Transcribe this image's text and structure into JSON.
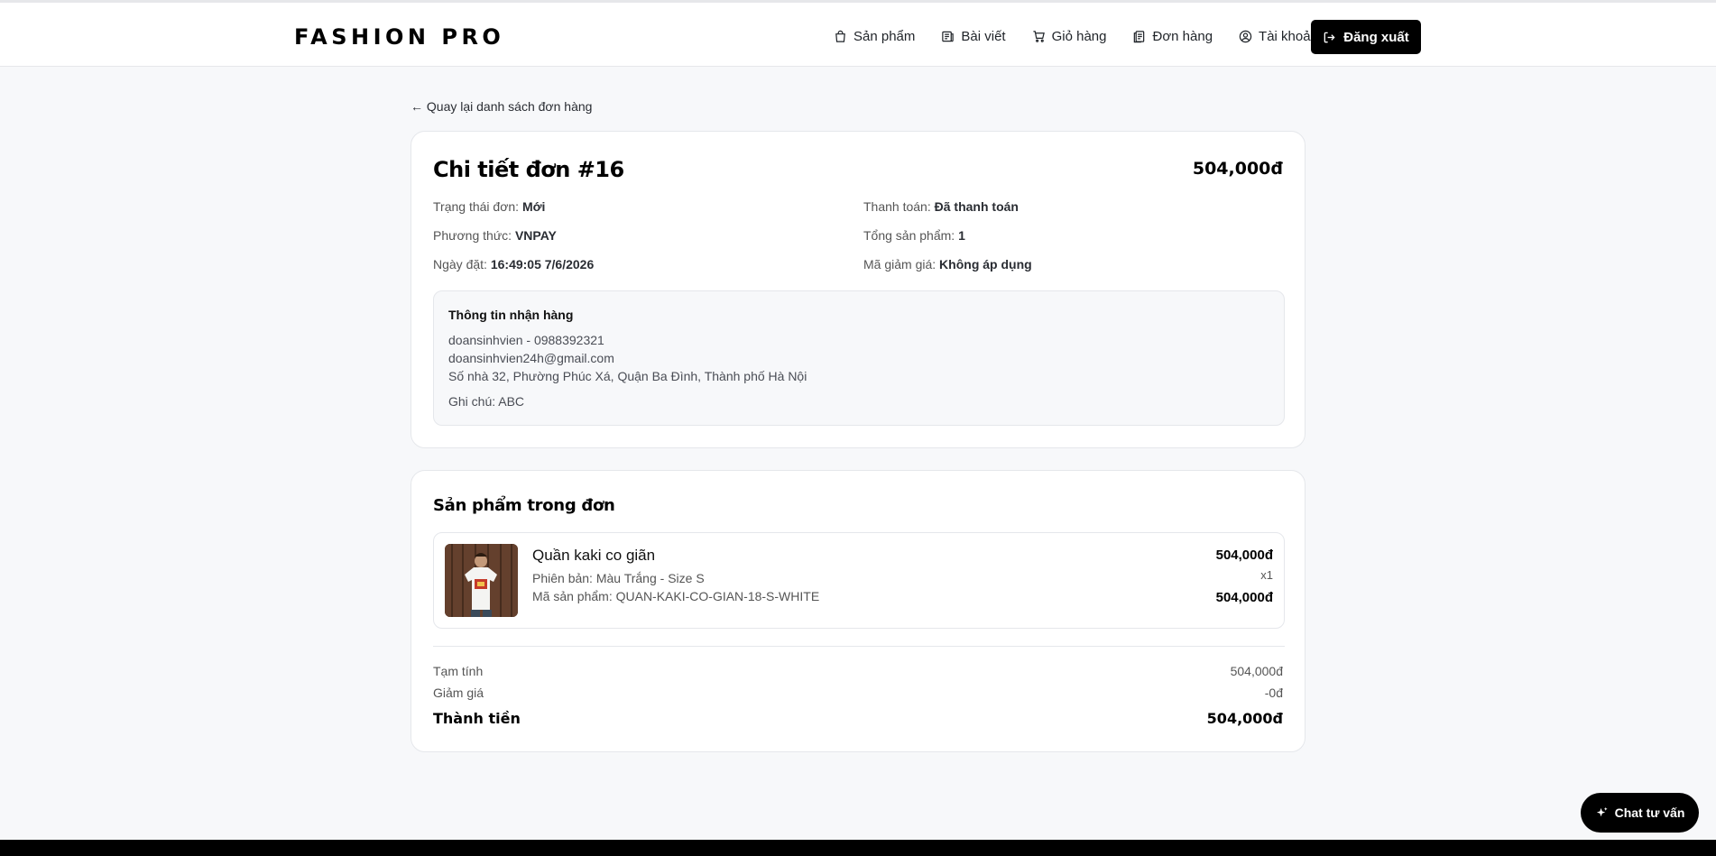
{
  "header": {
    "logo": "FASHION PRO",
    "nav": [
      {
        "label": "Sản phẩm",
        "icon": "bag-icon"
      },
      {
        "label": "Bài viết",
        "icon": "newspaper-icon"
      },
      {
        "label": "Giỏ hàng",
        "icon": "cart-icon"
      },
      {
        "label": "Đơn hàng",
        "icon": "orders-icon"
      },
      {
        "label": "Tài khoản",
        "icon": "user-icon"
      }
    ],
    "logout_label": "Đăng xuất"
  },
  "back_link": "← Quay lại danh sách đơn hàng",
  "order": {
    "title": "Chi tiết đơn #16",
    "total": "504,000đ",
    "status_label": "Trạng thái đơn:",
    "status_value": "Mới",
    "payment_label": "Thanh toán:",
    "payment_value": "Đã thanh toán",
    "method_label": "Phương thức:",
    "method_value": "VNPAY",
    "items_count_label": "Tổng sản phẩm:",
    "items_count_value": "1",
    "date_label": "Ngày đặt:",
    "date_value": "16:49:05 7/6/2026",
    "coupon_label": "Mã giảm giá:",
    "coupon_value": "Không áp dụng"
  },
  "shipping": {
    "title": "Thông tin nhận hàng",
    "name_phone": "doansinhvien - 0988392321",
    "email": "doansinhvien24h@gmail.com",
    "address": "Số nhà 32, Phường Phúc Xá, Quận Ba Đình, Thành phố Hà Nội",
    "note": "Ghi chú: ABC"
  },
  "items_section": {
    "title": "Sản phẩm trong đơn",
    "items": [
      {
        "name": "Quần kaki co giãn",
        "variant": "Phiên bản: Màu Trắng - Size S",
        "sku": "Mã sản phẩm: QUAN-KAKI-CO-GIAN-18-S-WHITE",
        "price": "504,000đ",
        "qty": "x1",
        "line_total": "504,000đ"
      }
    ]
  },
  "summary": {
    "subtotal_label": "Tạm tính",
    "subtotal_value": "504,000đ",
    "discount_label": "Giảm giá",
    "discount_value": "-0đ",
    "grand_label": "Thành tiền",
    "grand_value": "504,000đ"
  },
  "chat_button": "Chat tư vấn",
  "colors": {
    "primary": "#000000",
    "background": "#f7f8fa",
    "card": "#ffffff",
    "border": "#e5e7eb"
  }
}
